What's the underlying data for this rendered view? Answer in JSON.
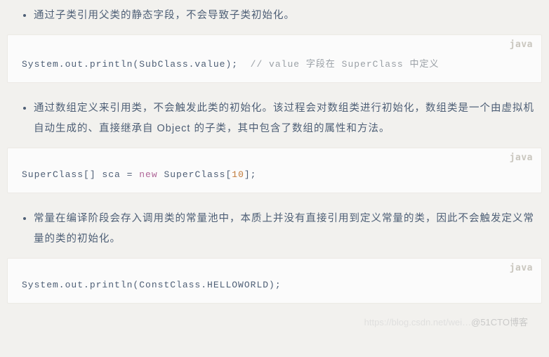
{
  "items": [
    {
      "bullet": "通过子类引用父类的静态字段，不会导致子类初始化。",
      "lang": "java",
      "code_html": "System.out.println(SubClass.value);  <span class=\"tok-comment\">// value 字段在 SuperClass 中定义</span>"
    },
    {
      "bullet": "通过数组定义来引用类，不会触发此类的初始化。该过程会对数组类进行初始化，数组类是一个由虚拟机自动生成的、直接继承自 Object 的子类，其中包含了数组的属性和方法。",
      "lang": "java",
      "code_html": "SuperClass[] sca = <span class=\"tok-kw\">new</span> SuperClass[<span class=\"tok-num\">10</span>];"
    },
    {
      "bullet": "常量在编译阶段会存入调用类的常量池中，本质上并没有直接引用到定义常量的类，因此不会触发定义常量的类的初始化。",
      "lang": "java",
      "code_html": "System.out.println(ConstClass.HELLOWORLD);"
    }
  ],
  "watermark": {
    "faint": "https://blog.csdn.net/wei…",
    "main": "@51CTO博客"
  }
}
